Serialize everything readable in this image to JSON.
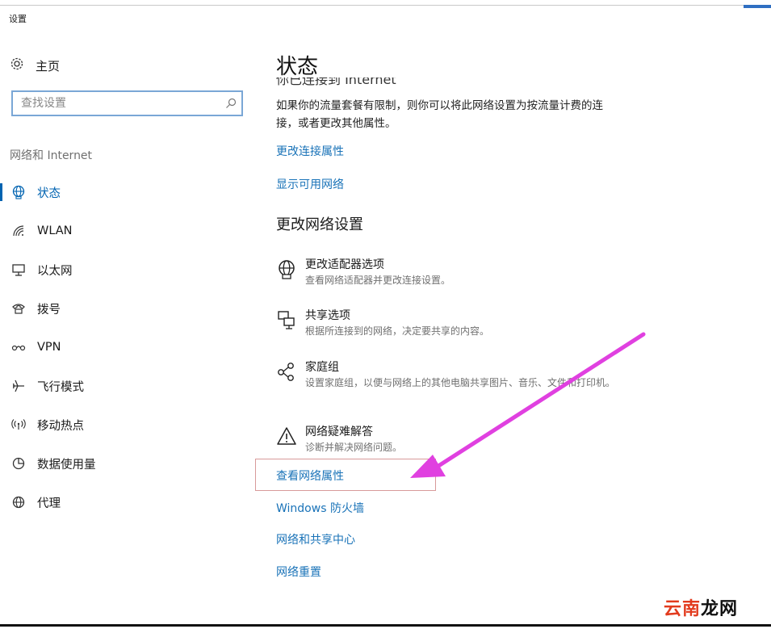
{
  "app": {
    "title": "设置"
  },
  "sidebar": {
    "home_label": "主页",
    "search_placeholder": "查找设置",
    "section_label": "网络和 Internet",
    "items": [
      {
        "label": "状态",
        "icon": "globe-icon",
        "active": true
      },
      {
        "label": "WLAN",
        "icon": "wifi-icon"
      },
      {
        "label": "以太网",
        "icon": "ethernet-icon"
      },
      {
        "label": "拨号",
        "icon": "dialup-icon"
      },
      {
        "label": "VPN",
        "icon": "vpn-icon"
      },
      {
        "label": "飞行模式",
        "icon": "airplane-icon"
      },
      {
        "label": "移动热点",
        "icon": "hotspot-icon"
      },
      {
        "label": "数据使用量",
        "icon": "data-usage-icon"
      },
      {
        "label": "代理",
        "icon": "proxy-globe-icon"
      }
    ]
  },
  "main": {
    "title": "状态",
    "clipped_line": "你已连接到 Internet",
    "description": "如果你的流量套餐有限制，则你可以将此网络设置为按流量计费的连接，或者更改其他属性。",
    "link_change_connection": "更改连接属性",
    "link_show_networks": "显示可用网络",
    "section_title": "更改网络设置",
    "options": [
      {
        "title": "更改适配器选项",
        "subtitle": "查看网络适配器并更改连接设置。",
        "icon": "adapter-icon"
      },
      {
        "title": "共享选项",
        "subtitle": "根据所连接到的网络，决定要共享的内容。",
        "icon": "sharing-icon"
      },
      {
        "title": "家庭组",
        "subtitle": "设置家庭组，以便与网络上的其他电脑共享图片、音乐、文件和打印机。",
        "icon": "homegroup-icon"
      },
      {
        "title": "网络疑难解答",
        "subtitle": "诊断并解决网络问题。",
        "icon": "warning-icon"
      }
    ],
    "links": {
      "view_properties": "查看网络属性",
      "firewall": "Windows 防火墙",
      "sharing_center": "网络和共享中心",
      "reset": "网络重置"
    }
  },
  "annotation": {
    "arrow_color": "#e040e0",
    "box_color": "#d89a9a"
  },
  "watermark": {
    "part1": "云南",
    "part2": "龙网",
    "color1": "#e23b1e",
    "color2": "#111111"
  },
  "colors": {
    "accent": "#0063b1",
    "link": "#1a73b8"
  }
}
